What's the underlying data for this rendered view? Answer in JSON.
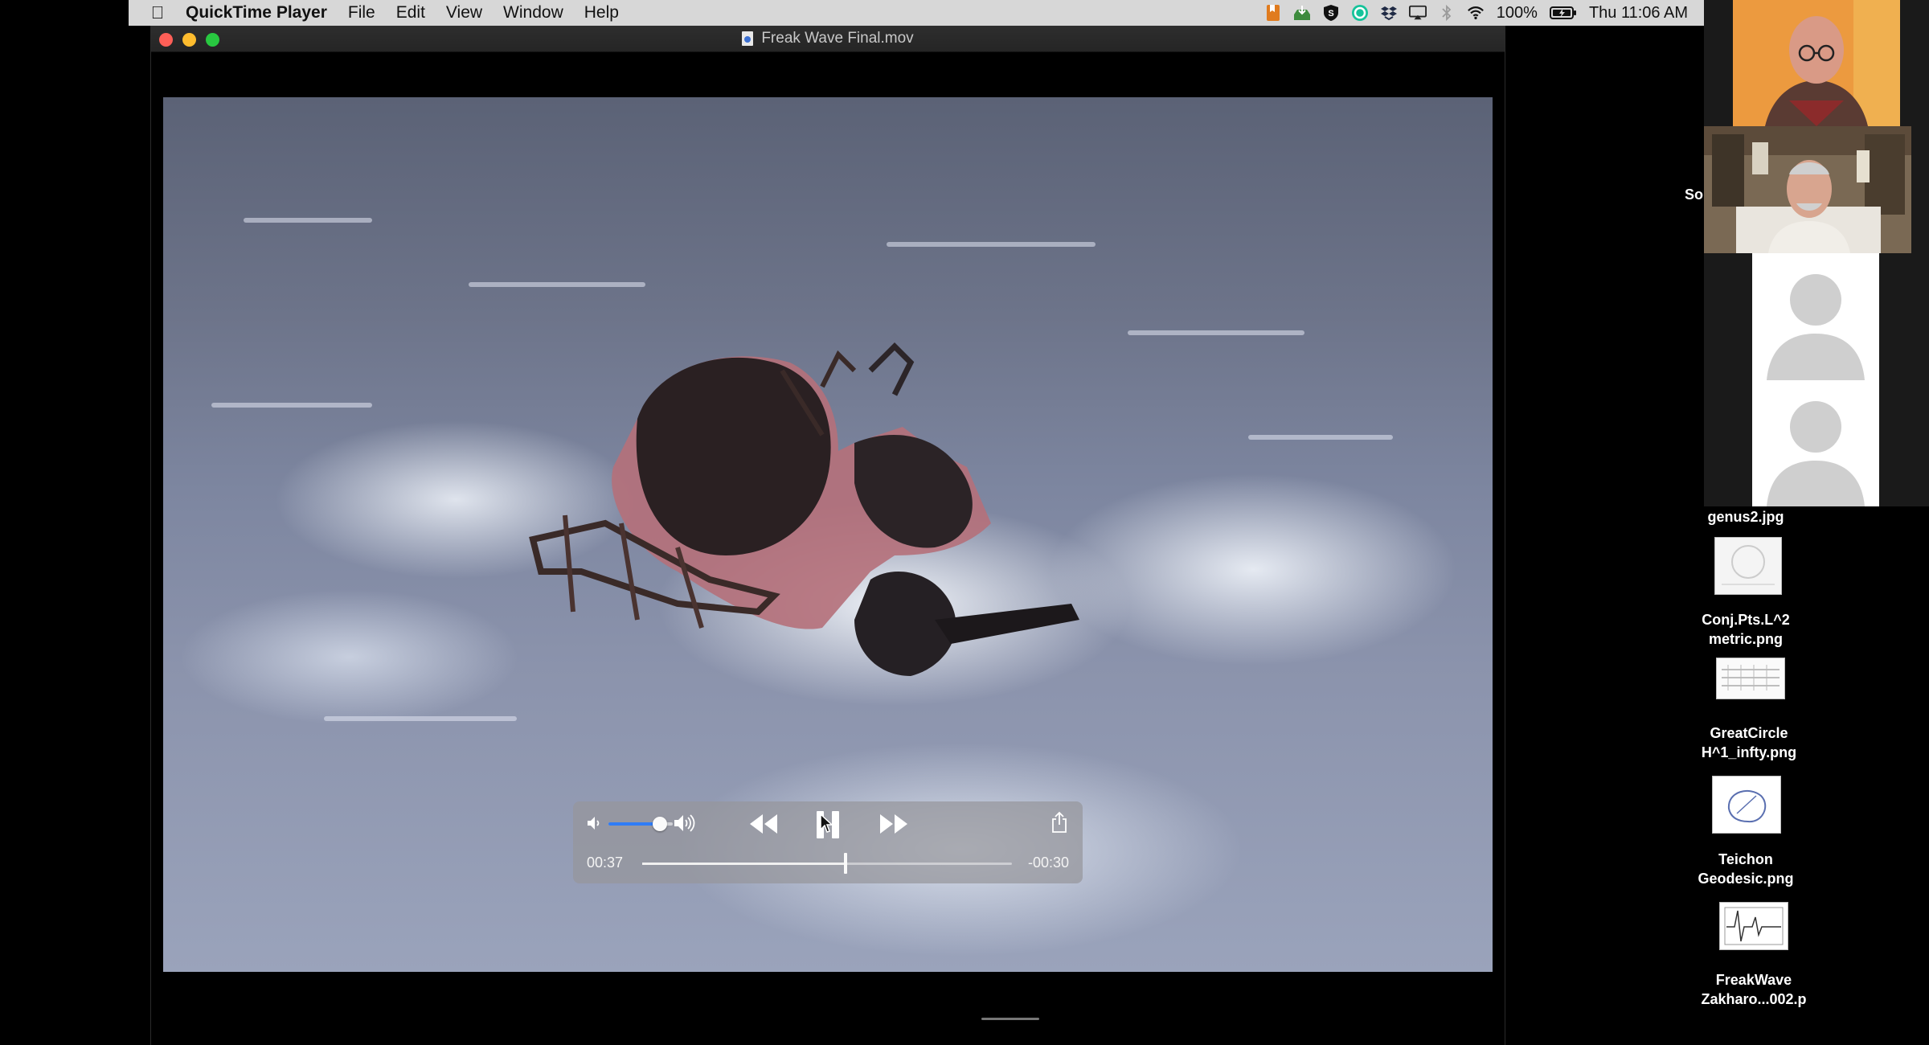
{
  "menubar": {
    "apple_icon": "apple-logo",
    "app_name": "QuickTime Player",
    "menus": [
      "File",
      "Edit",
      "View",
      "Window",
      "Help"
    ],
    "battery": "100%",
    "clock": "Thu 11:06 AM"
  },
  "window": {
    "title": "Freak Wave Final.mov"
  },
  "player": {
    "elapsed": "00:37",
    "remaining": "-00:30",
    "progress_fraction": 0.55,
    "volume_fraction": 0.8,
    "state": "playing"
  },
  "conference": {
    "side_label": "So"
  },
  "desktop_files": [
    {
      "line1": "genus2.jpg",
      "line2": ""
    },
    {
      "line1": "Conj.Pts.L^2",
      "line2": "metric.png"
    },
    {
      "line1": "GreatCircle",
      "line2": "H^1_infty.png"
    },
    {
      "line1": "Teichon",
      "line2": "Geodesic.png"
    },
    {
      "line1": "FreakWave",
      "line2": "Zakharo...002.p"
    }
  ],
  "colors": {
    "menubar_bg": "#d7d7d7",
    "accent": "#2f7cf6",
    "close": "#fe5f57",
    "minimize": "#febc2e",
    "zoom": "#28c840"
  }
}
